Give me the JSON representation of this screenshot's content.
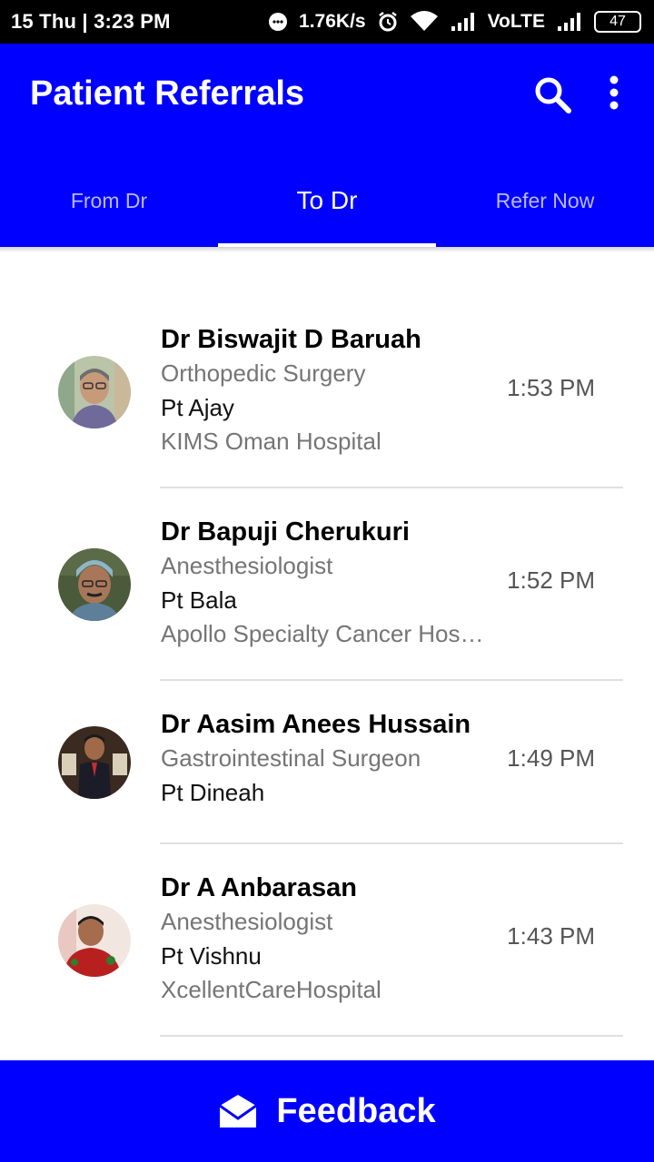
{
  "status_bar": {
    "time": "15 Thu | 3:23 PM",
    "speed": "1.76K/s",
    "network": "VoLTE",
    "battery": "47"
  },
  "app_bar": {
    "title": "Patient Referrals",
    "accent_color": "#0000ff"
  },
  "tabs": [
    {
      "label": "From Dr"
    },
    {
      "label": "To Dr"
    },
    {
      "label": "Refer Now"
    }
  ],
  "referrals": [
    {
      "doctor": "Dr Biswajit D Baruah",
      "specialty": "Orthopedic Surgery",
      "patient": "Pt Ajay",
      "hospital": "KIMS Oman Hospital",
      "time": "1:53 PM"
    },
    {
      "doctor": "Dr Bapuji Cherukuri",
      "specialty": "Anesthesiologist",
      "patient": "Pt Bala",
      "hospital": "Apollo Specialty Cancer Hospital",
      "time": "1:52 PM"
    },
    {
      "doctor": "Dr Aasim Anees Hussain",
      "specialty": "Gastrointestinal Surgeon",
      "patient": "Pt Dineah",
      "time": "1:49 PM"
    },
    {
      "doctor": "Dr A Anbarasan",
      "specialty": "Anesthesiologist",
      "patient": "Pt Vishnu",
      "hospital": "XcellentCareHospital",
      "time": "1:43 PM"
    }
  ],
  "feedback": {
    "label": "Feedback",
    "icon": "envelope-open-icon"
  }
}
